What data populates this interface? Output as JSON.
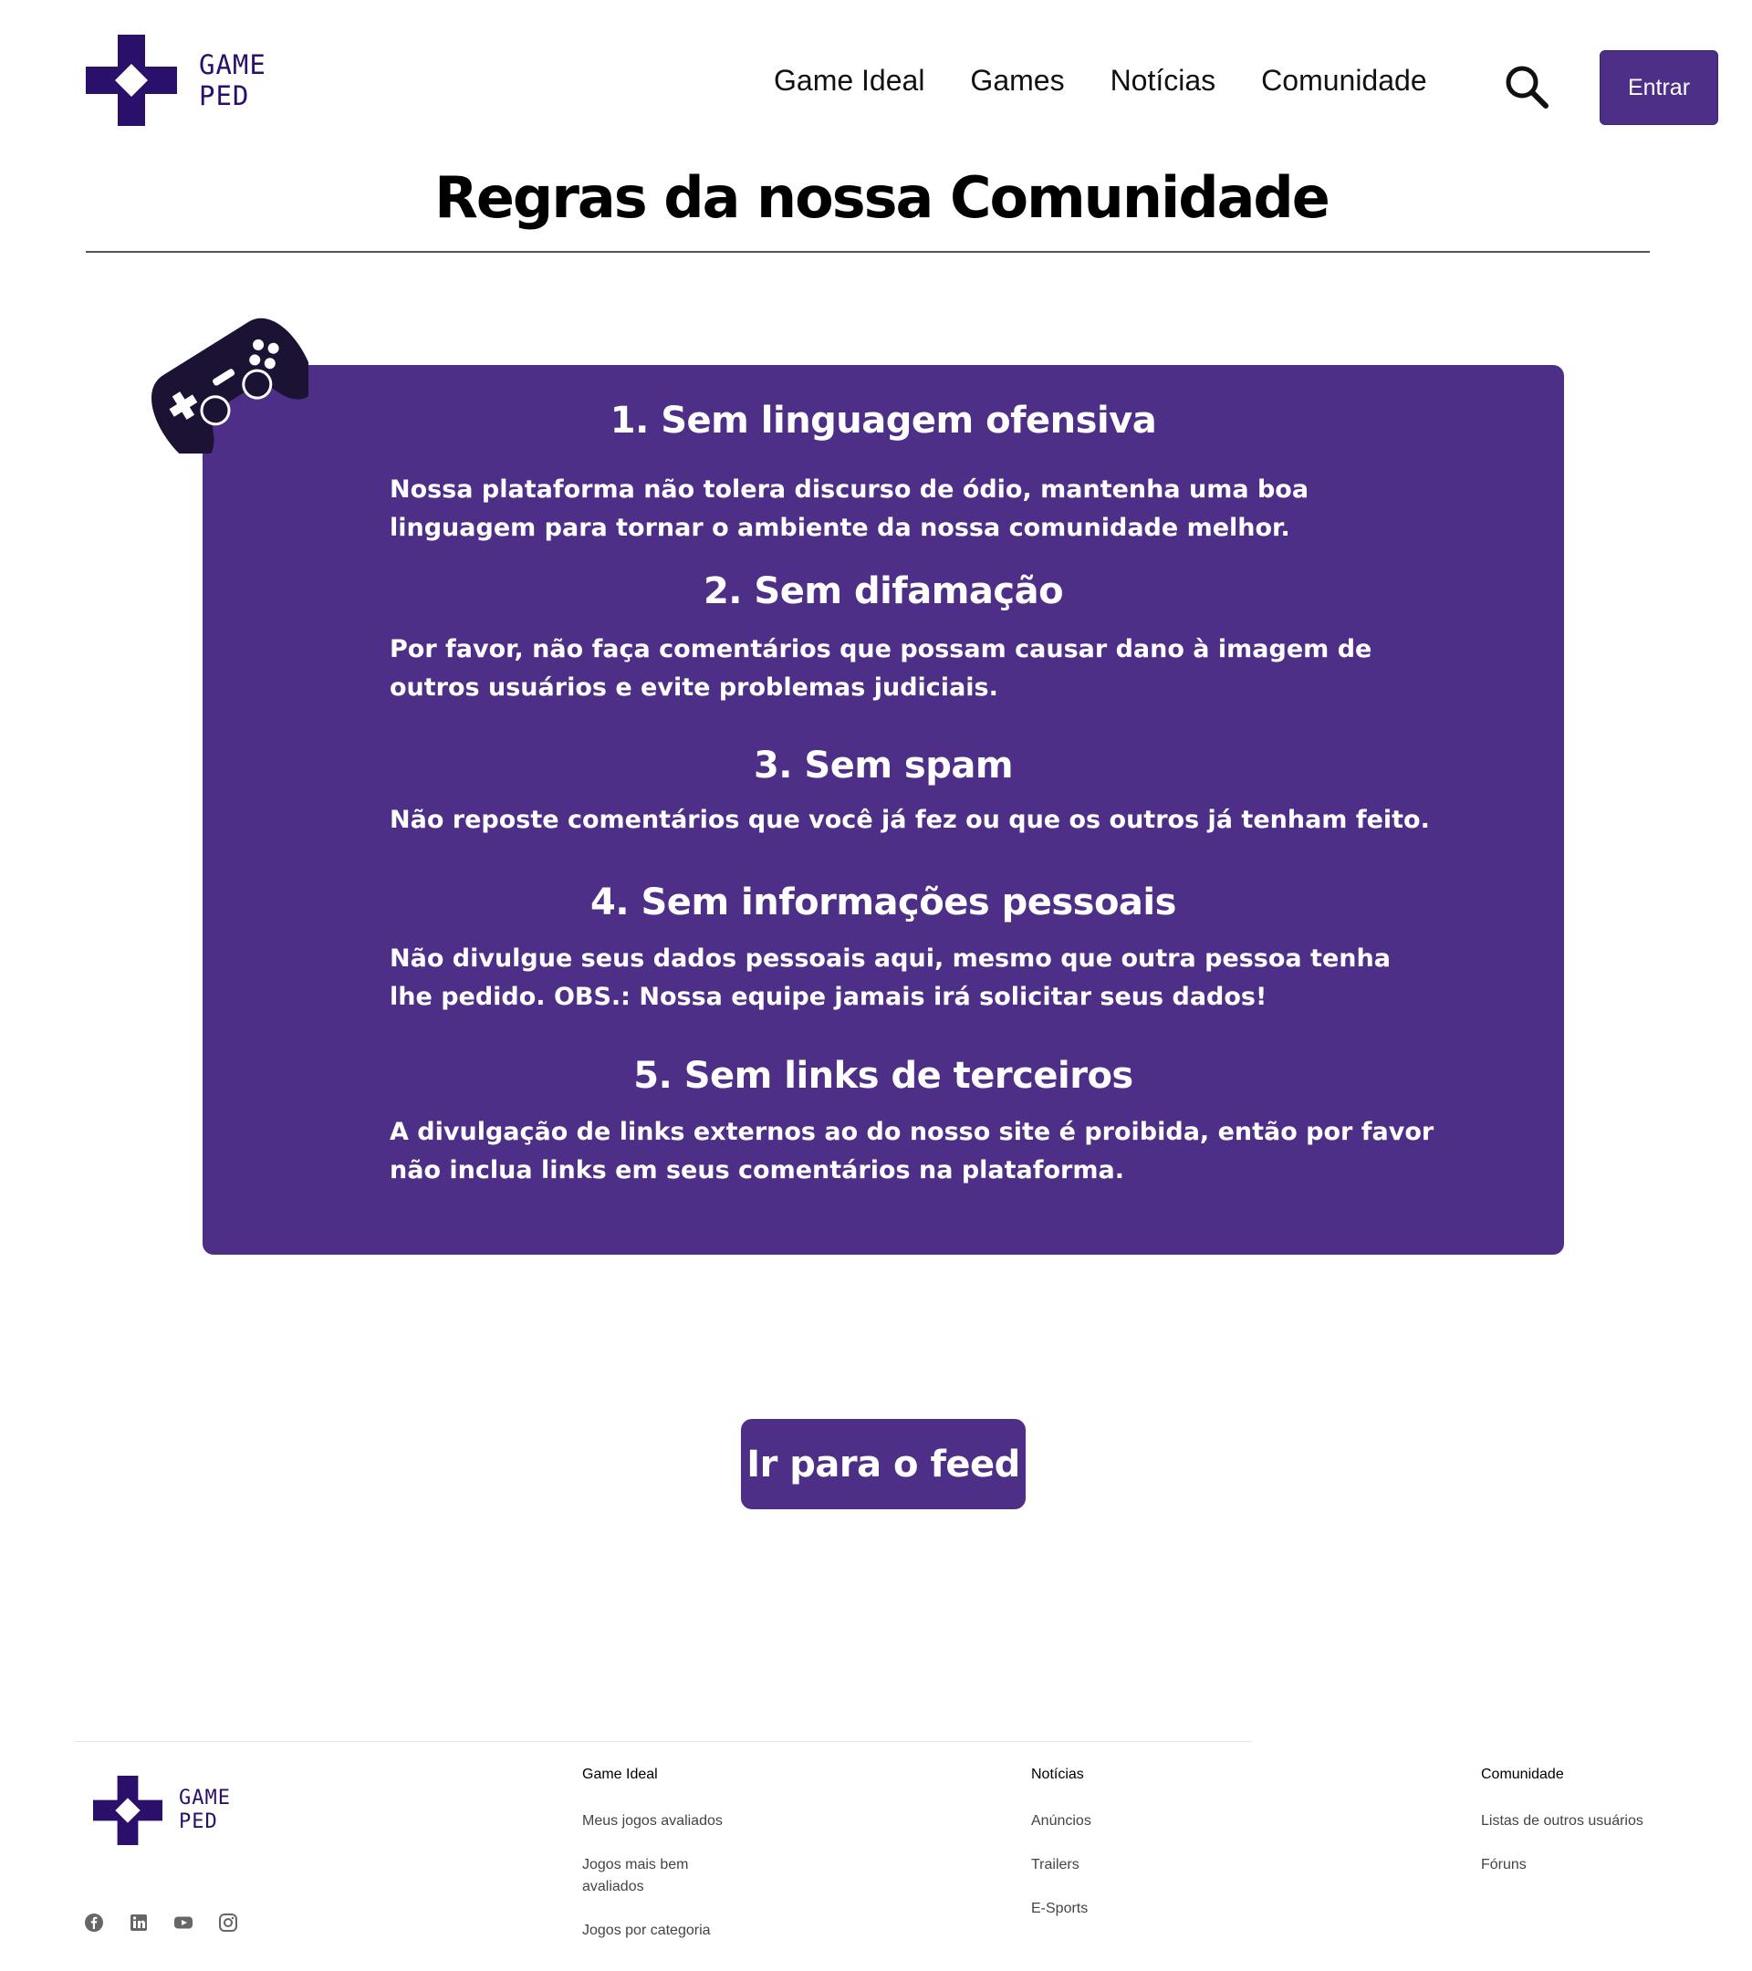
{
  "header": {
    "logo_text_line1": "GAME",
    "logo_text_line2": "PED",
    "nav": [
      "Game Ideal",
      "Games",
      "Notícias",
      "Comunidade"
    ],
    "search_icon": "search-icon",
    "login_label": "Entrar"
  },
  "page": {
    "title": "Regras da nossa Comunidade"
  },
  "rules": [
    {
      "title": "1.  Sem linguagem ofensiva",
      "text": "Nossa plataforma não tolera discurso de ódio, mantenha uma boa linguagem para tornar o ambiente da nossa comunidade melhor."
    },
    {
      "title": "2.  Sem difamação",
      "text": "Por favor, não faça comentários que possam causar dano à imagem de outros usuários e evite problemas judiciais."
    },
    {
      "title": "3.  Sem spam",
      "text": "Não reposte comentários que você já fez ou que os outros já tenham feito."
    },
    {
      "title": "4.  Sem informações pessoais",
      "text": "Não divulgue seus dados pessoais aqui, mesmo que outra pessoa tenha lhe pedido. OBS.: Nossa equipe jamais irá solicitar seus dados!"
    },
    {
      "title": "5.  Sem  links de terceiros",
      "text": "A divulgação de links externos ao do nosso site é proibida, então por favor não inclua links em seus comentários na plataforma."
    }
  ],
  "feed_button": "Ir para o feed",
  "footer": {
    "logo_text_line1": "GAME",
    "logo_text_line2": "PED",
    "columns": [
      {
        "heading": "Game Ideal",
        "links": [
          "Meus jogos avaliados",
          "Jogos mais bem avaliados",
          "Jogos por categoria"
        ]
      },
      {
        "heading": "Notícias",
        "links": [
          "Anúncios",
          "Trailers",
          "E-Sports"
        ]
      },
      {
        "heading": "Comunidade",
        "links": [
          "Listas de outros usuários",
          "Fóruns"
        ]
      }
    ],
    "socials": [
      "facebook-icon",
      "linkedin-icon",
      "youtube-icon",
      "instagram-icon"
    ]
  },
  "colors": {
    "accent": "#4e2f87",
    "logo": "#2a0f6b"
  }
}
